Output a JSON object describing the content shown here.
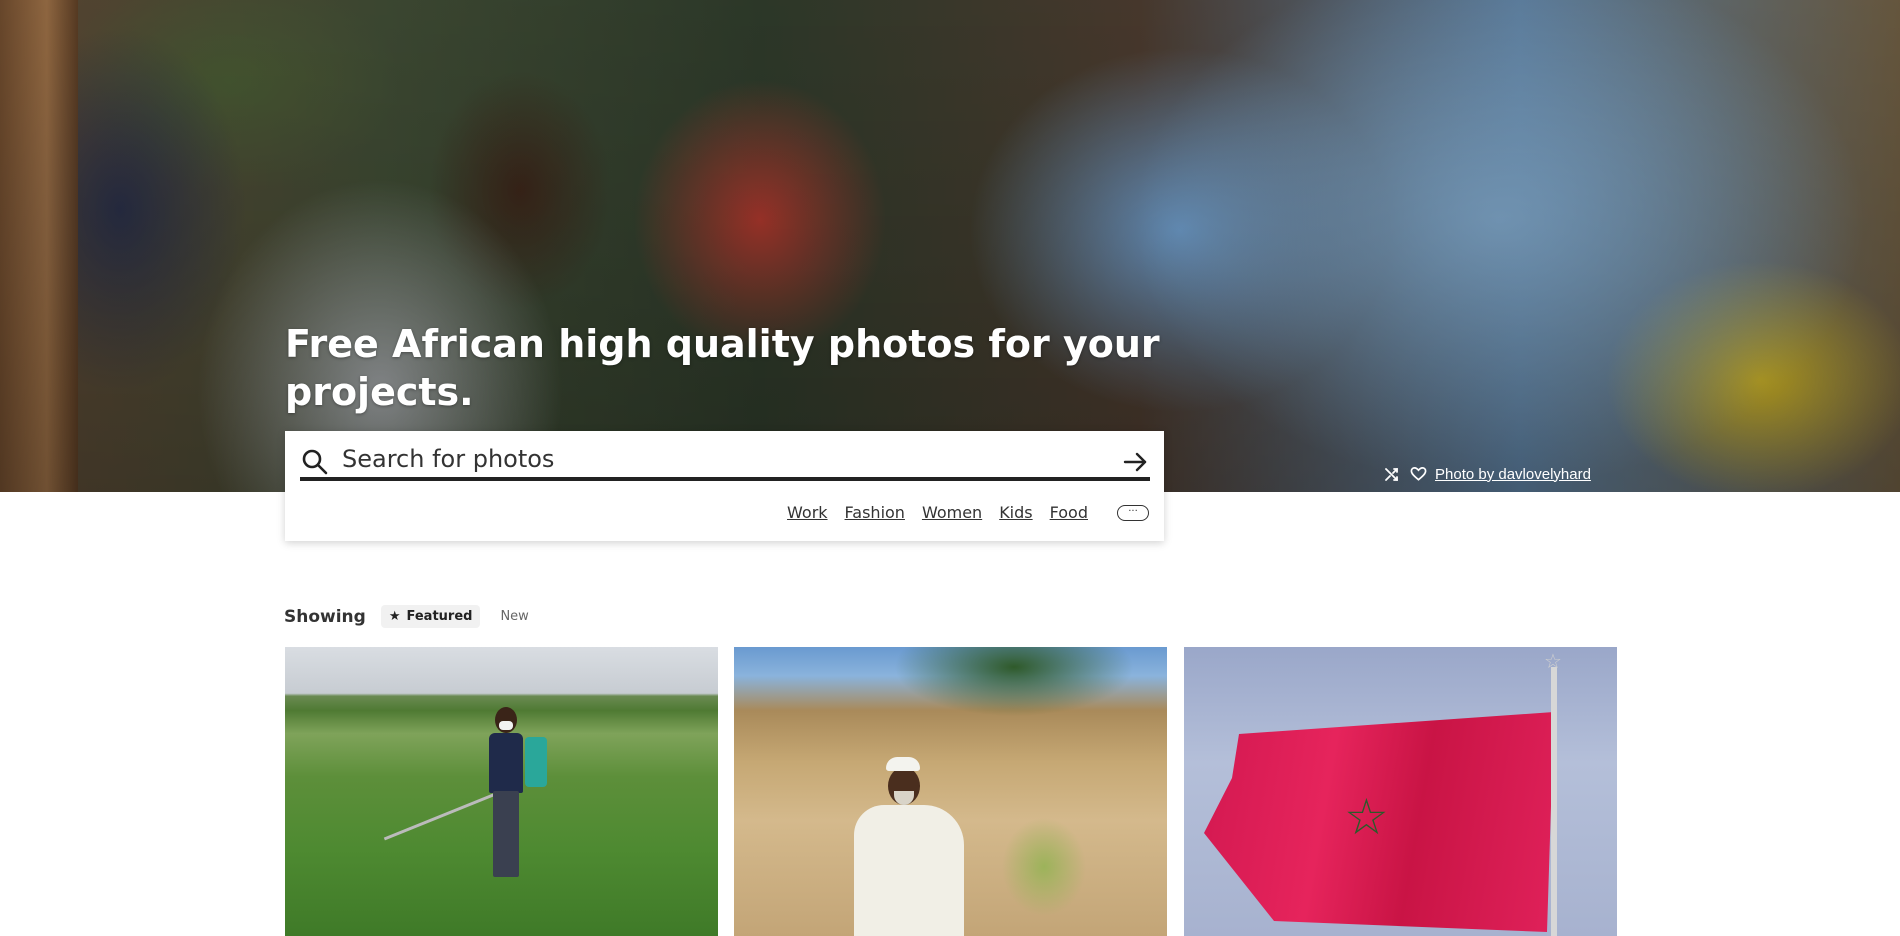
{
  "hero": {
    "title": "Free African high quality photos for your projects.",
    "credit_text": "Photo by davlovelyhard",
    "icons": [
      "shuffle-icon",
      "heart-icon"
    ]
  },
  "search": {
    "placeholder": "Search for photos",
    "value": "",
    "tags": [
      "Work",
      "Fashion",
      "Women",
      "Kids",
      "Food"
    ],
    "more_label": "···"
  },
  "showing": {
    "label": "Showing",
    "featured_label": "Featured",
    "new_label": "New"
  },
  "photos": [
    {
      "subject": "farmer spraying crops"
    },
    {
      "subject": "man in sorghum field"
    },
    {
      "subject": "Moroccan flag"
    }
  ]
}
